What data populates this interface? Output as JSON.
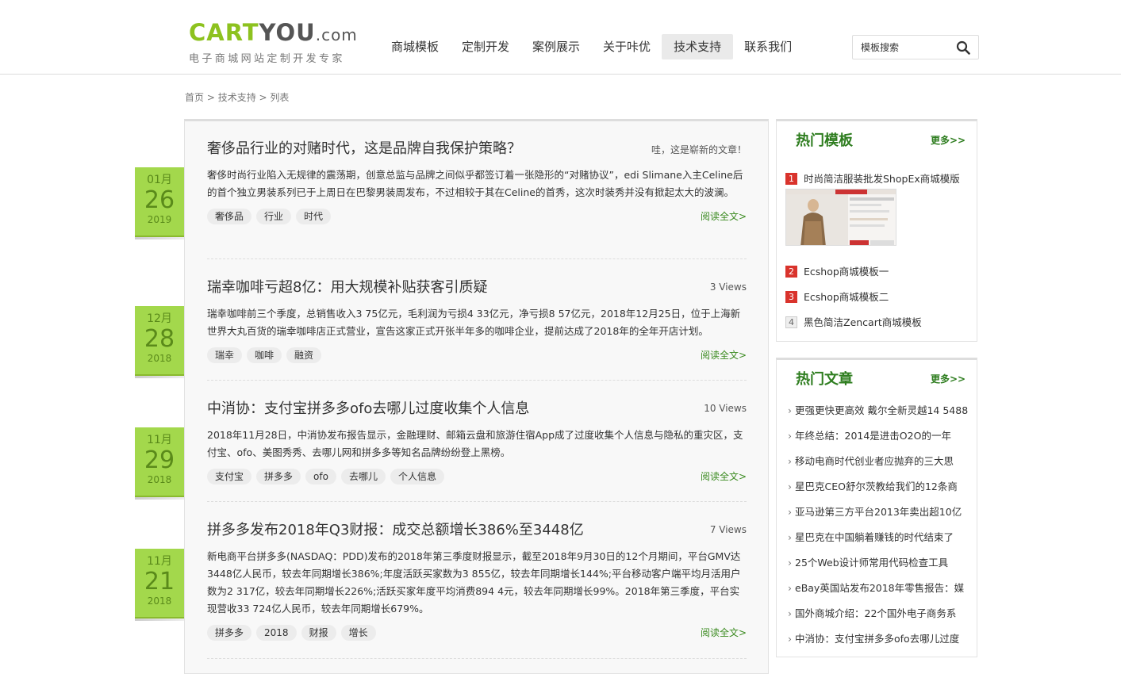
{
  "logo": {
    "cart": "CART",
    "you": "YOU",
    "dom": ".com",
    "tagline": "电子商城网站定制开发专家"
  },
  "nav": [
    "商城模板",
    "定制开发",
    "案例展示",
    "关于咔优",
    "技术支持",
    "联系我们"
  ],
  "search": {
    "placeholder": "模板搜索",
    "icon": "search-icon"
  },
  "breadcrumb": {
    "home": "首页",
    "sep1": " > ",
    "section": "技术支持",
    "sep2": " > ",
    "current": "列表"
  },
  "articles": [
    {
      "month": "01月",
      "day": "26",
      "year": "2019",
      "title": "奢侈品行业的对赌时代，这是品牌自我保护策略？",
      "meta": "哇，这是崭新的文章！",
      "body": "奢侈时尚行业陷入无规律的震荡期，创意总监与品牌之间似乎都签订着一张隐形的“对赌协议”，edi Slimane入主Celine后的首个独立男装系列已于上周日在巴黎男装周发布，不过相较于其在Celine的首秀，这次时装秀并没有掀起太大的波澜。",
      "tags": [
        "奢侈品",
        "行业",
        "时代"
      ],
      "read_more": "阅读全文>"
    },
    {
      "month": "12月",
      "day": "28",
      "year": "2018",
      "title": "瑞幸咖啡亏超8亿：用大规模补贴获客引质疑",
      "meta": "3 Views",
      "body": "瑞幸咖啡前三个季度，总销售收入3 75亿元，毛利润为亏损4 33亿元，净亏损8 57亿元，2018年12月25日，位于上海新世界大丸百货的瑞幸咖啡店正式营业，宣告这家正式开张半年多的咖啡企业，提前达成了2018年的全年开店计划。",
      "tags": [
        "瑞幸",
        "咖啡",
        "融资"
      ],
      "read_more": "阅读全文>"
    },
    {
      "month": "11月",
      "day": "29",
      "year": "2018",
      "title": "中消协：支付宝拼多多ofo去哪儿过度收集个人信息",
      "meta": "10 Views",
      "body": "2018年11月28日，中消协发布报告显示，金融理财、邮箱云盘和旅游住宿App成了过度收集个人信息与隐私的重灾区，支付宝、ofo、美图秀秀、去哪儿网和拼多多等知名品牌纷纷登上黑榜。",
      "tags": [
        "支付宝",
        "拼多多",
        "ofo",
        "去哪儿",
        "个人信息"
      ],
      "read_more": "阅读全文>"
    },
    {
      "month": "11月",
      "day": "21",
      "year": "2018",
      "title": "拼多多发布2018年Q3财报：成交总额增长386%至3448亿",
      "meta": "7 Views",
      "body": "新电商平台拼多多(NASDAQ：PDD)发布的2018年第三季度财报显示，截至2018年9月30日的12个月期间，平台GMV达3448亿人民币，较去年同期增长386%;年度活跃买家数为3 855亿，较去年同期增长144%;平台移动客户端平均月活用户数为2 317亿，较去年同期增长226%;活跃买家年度平均消费894 4元，较去年同期增长99%。2018年第三季度，平台实现营收33 724亿人民币，较去年同期增长679%。",
      "tags": [
        "拼多多",
        "2018",
        "财报",
        "增长"
      ],
      "read_more": "阅读全文>"
    }
  ],
  "hot_templates": {
    "title": "热门模板",
    "more": "更多>>",
    "items": [
      {
        "rank": "1",
        "label": "时尚简洁服装批发ShopEx商城模版"
      },
      {
        "rank": "2",
        "label": "Ecshop商城模板一"
      },
      {
        "rank": "3",
        "label": "Ecshop商城模板二"
      },
      {
        "rank": "4",
        "label": "黑色简洁Zencart商城模板"
      }
    ]
  },
  "hot_posts": {
    "title": "热门文章",
    "more": "更多>>",
    "items": [
      "更强更快更高效 戴尔全新灵越14 5488",
      "年终总结：2014是进击O2O的一年",
      "移动电商时代创业者应抛弃的三大思",
      "星巴克CEO舒尔茨教给我们的12条商",
      "亚马逊第三方平台2013年卖出超10亿",
      "星巴克在中国躺着赚钱的时代结束了",
      "25个Web设计师常用代码检查工具",
      "eBay英国站发布2018年零售报告：媒",
      "国外商城介绍：22个国外电子商务系",
      "中消协：支付宝拼多多ofo去哪儿过度"
    ]
  }
}
